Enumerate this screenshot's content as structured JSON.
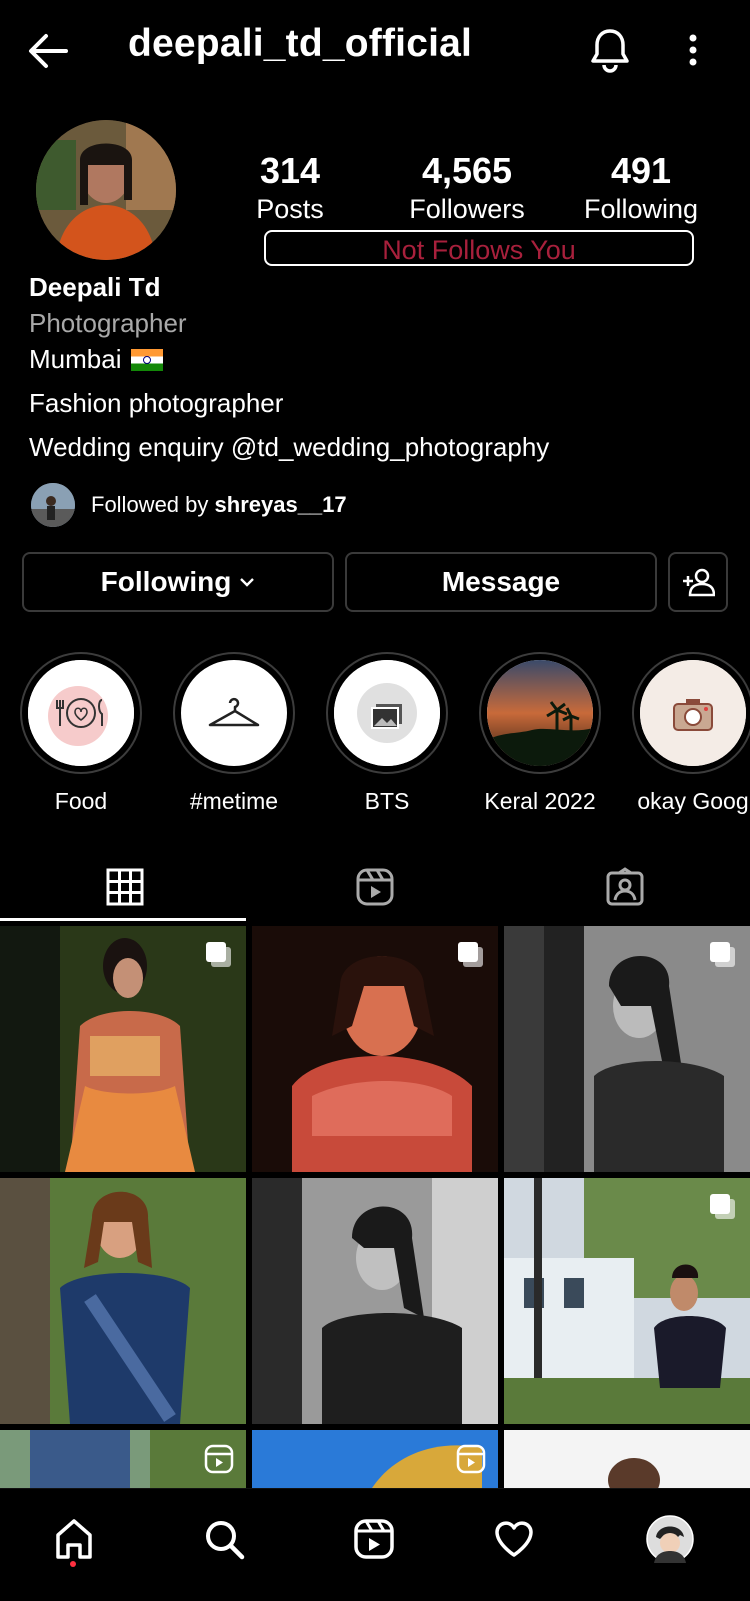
{
  "header": {
    "title": "deepali_td_official",
    "back_icon": "arrow-left-icon",
    "bell_icon": "bell-icon",
    "more_icon": "more-vertical-icon"
  },
  "stats": [
    {
      "value": "314",
      "label": "Posts"
    },
    {
      "value": "4,565",
      "label": "Followers"
    },
    {
      "value": "491",
      "label": "Following"
    }
  ],
  "follow_status": "Not Follows You",
  "profile": {
    "name": "Deepali Td",
    "category": "Photographer",
    "bio_city": "Mumbai",
    "bio_line2": "Fashion photographer",
    "bio_line3": "Wedding enquiry @td_wedding_photography"
  },
  "followed_by": {
    "prefix": "Followed by ",
    "user": "shreyas__17"
  },
  "buttons": {
    "following": "Following",
    "message": "Message"
  },
  "highlights": [
    {
      "label": "Food"
    },
    {
      "label": "#metime"
    },
    {
      "label": "BTS"
    },
    {
      "label": "Keral 2022"
    },
    {
      "label": "okay Goog"
    }
  ],
  "tabs": [
    "grid-icon",
    "reels-icon",
    "tagged-icon"
  ],
  "nav": [
    "home-icon",
    "search-icon",
    "reels-icon",
    "heart-icon",
    "profile-avatar"
  ],
  "colors": {
    "background": "#000000",
    "not_follows": "#a8203c",
    "notification_dot": "#ff3040",
    "button_border": "#3a3a3a",
    "muted_text": "#a9a9a9"
  }
}
